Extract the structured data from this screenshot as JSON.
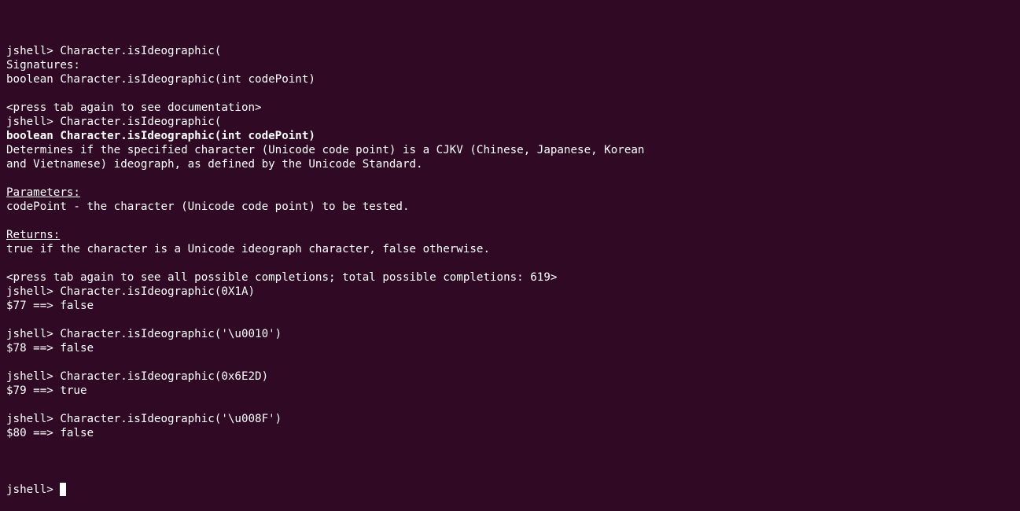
{
  "colors": {
    "background": "#300a24",
    "foreground": "#ffffff"
  },
  "prompt": "jshell> ",
  "lines": [
    {
      "text": "jshell> Character.isIdeographic(",
      "style": "normal"
    },
    {
      "text": "Signatures:",
      "style": "normal"
    },
    {
      "text": "boolean Character.isIdeographic(int codePoint)",
      "style": "normal"
    },
    {
      "text": "",
      "style": "normal"
    },
    {
      "text": "<press tab again to see documentation>",
      "style": "normal"
    },
    {
      "text": "jshell> Character.isIdeographic(",
      "style": "normal"
    },
    {
      "text": "boolean Character.isIdeographic(int codePoint)",
      "style": "bold"
    },
    {
      "text": "Determines if the specified character (Unicode code point) is a CJKV (Chinese, Japanese, Korean",
      "style": "normal"
    },
    {
      "text": "and Vietnamese) ideograph, as defined by the Unicode Standard.",
      "style": "normal"
    },
    {
      "text": "",
      "style": "normal"
    },
    {
      "text": "Parameters:",
      "style": "underline"
    },
    {
      "text": "codePoint - the character (Unicode code point) to be tested.",
      "style": "normal"
    },
    {
      "text": "",
      "style": "normal"
    },
    {
      "text": "Returns:",
      "style": "underline"
    },
    {
      "text": "true if the character is a Unicode ideograph character, false otherwise.",
      "style": "normal"
    },
    {
      "text": "",
      "style": "normal"
    },
    {
      "text": "<press tab again to see all possible completions; total possible completions: 619>",
      "style": "normal"
    },
    {
      "text": "jshell> Character.isIdeographic(0X1A)",
      "style": "normal"
    },
    {
      "text": "$77 ==> false",
      "style": "normal"
    },
    {
      "text": "",
      "style": "normal"
    },
    {
      "text": "jshell> Character.isIdeographic('\\u0010')",
      "style": "normal"
    },
    {
      "text": "$78 ==> false",
      "style": "normal"
    },
    {
      "text": "",
      "style": "normal"
    },
    {
      "text": "jshell> Character.isIdeographic(0x6E2D)",
      "style": "normal"
    },
    {
      "text": "$79 ==> true",
      "style": "normal"
    },
    {
      "text": "",
      "style": "normal"
    },
    {
      "text": "jshell> Character.isIdeographic('\\u008F')",
      "style": "normal"
    },
    {
      "text": "$80 ==> false",
      "style": "normal"
    },
    {
      "text": "",
      "style": "normal"
    }
  ]
}
